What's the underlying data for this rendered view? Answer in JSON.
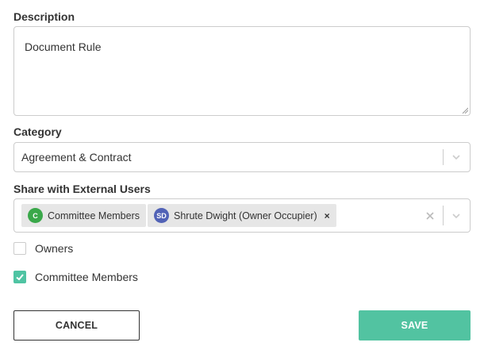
{
  "description": {
    "label": "Description",
    "value": "Document Rule"
  },
  "category": {
    "label": "Category",
    "selected": "Agreement & Contract"
  },
  "share": {
    "label": "Share with External Users",
    "chips": [
      {
        "initials": "C",
        "label": "Committee Members",
        "color": "#3aa84a",
        "removable": false
      },
      {
        "initials": "SD",
        "label": "Shrute Dwight (Owner Occupier)",
        "color": "#5162b6",
        "removable": true,
        "remove_glyph": "×"
      }
    ],
    "clear_glyph": "×"
  },
  "checkboxes": [
    {
      "label": "Owners",
      "checked": false
    },
    {
      "label": "Committee Members",
      "checked": true
    }
  ],
  "buttons": {
    "cancel": "CANCEL",
    "save": "SAVE"
  },
  "colors": {
    "accent": "#52c3a1",
    "border": "#cccccc",
    "text": "#333333"
  }
}
